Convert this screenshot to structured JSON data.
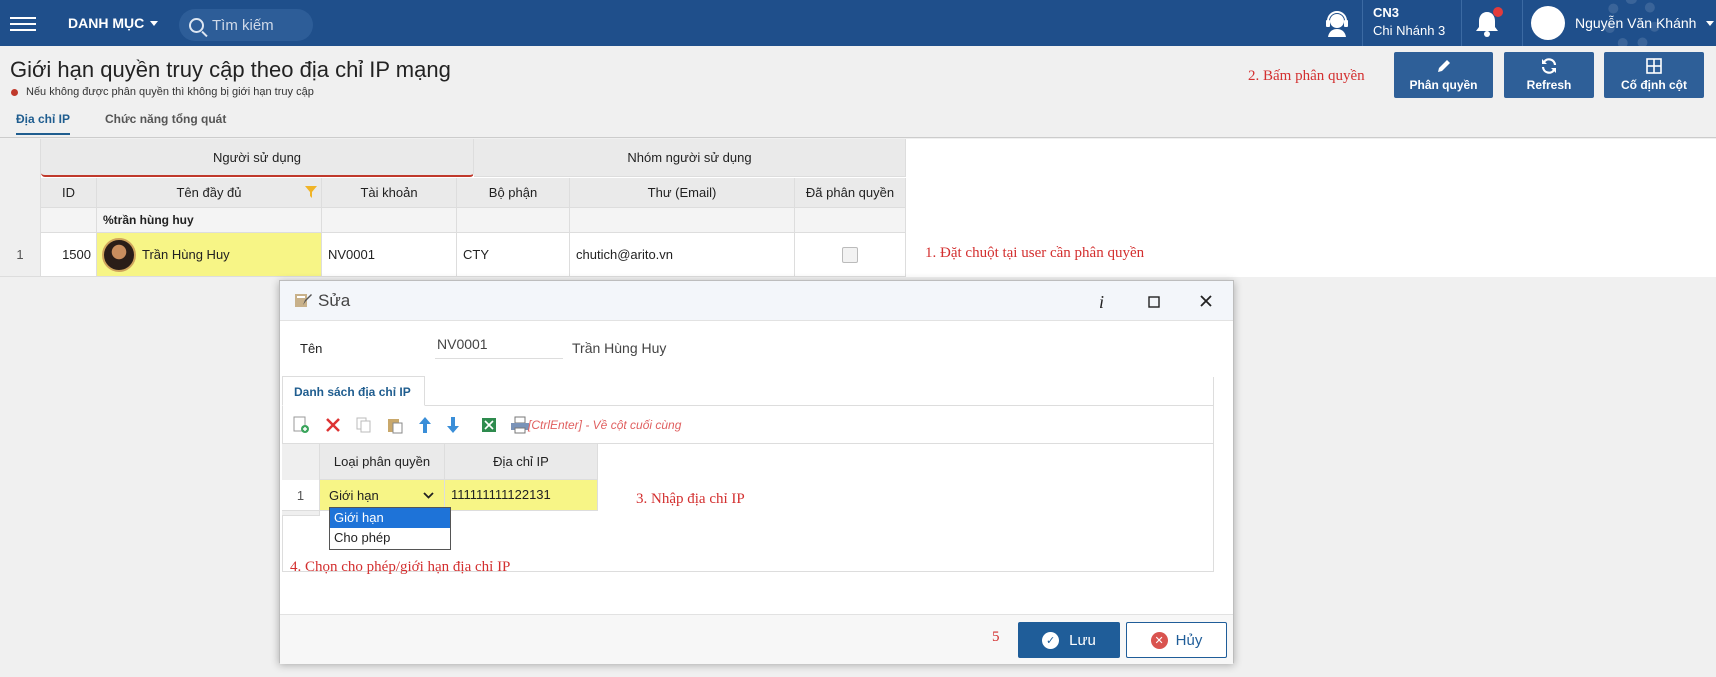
{
  "header": {
    "menu_label": "DANH MỤC",
    "search_placeholder": "Tìm kiếm",
    "branch_code": "CN3",
    "branch_name": "Chi Nhánh 3",
    "user_name": "Nguyễn Văn Khánh"
  },
  "page": {
    "title": "Giới hạn quyền truy cập theo địa chỉ IP mạng",
    "note": "Nếu không được phân quyền thì không bị giới hạn truy cập"
  },
  "toolbar": {
    "buttons": [
      {
        "label": "Phân quyền",
        "icon": "pencil-icon"
      },
      {
        "label": "Refresh",
        "icon": "refresh-icon"
      },
      {
        "label": "Cố định cột",
        "icon": "columns-icon"
      }
    ]
  },
  "tabs": [
    {
      "label": "Địa chỉ IP",
      "active": true
    },
    {
      "label": "Chức năng tổng quát",
      "active": false
    }
  ],
  "grid": {
    "group_headers": [
      "Người sử dụng",
      "Nhóm người sử dụng"
    ],
    "columns": [
      "ID",
      "Tên đầy đủ",
      "Tài khoản",
      "Bộ phận",
      "Thư (Email)",
      "Đã phân quyền"
    ],
    "filter_value": "%trần hùng huy",
    "rows": [
      {
        "index": "1",
        "id": "1500",
        "name": "Trần Hùng Huy",
        "account": "NV0001",
        "department": "CTY",
        "email": "chutich@arito.vn",
        "assigned": false
      }
    ]
  },
  "annotations": {
    "a1": "1. Đặt chuột tại user cần phân quyền",
    "a2": "2. Bấm phân quyền",
    "a3": "3. Nhập địa chỉ IP",
    "a4": "4. Chọn cho phép/giới hạn địa chỉ IP",
    "a5": "5"
  },
  "dialog": {
    "title": "Sửa",
    "name_label": "Tên",
    "code": "NV0001",
    "name": "Trần Hùng Huy",
    "tab_label": "Danh sách địa chỉ IP",
    "hint": "[CtrlEnter] - Về cột cuối cùng",
    "columns": [
      "Loại phân quyền",
      "Địa chỉ IP"
    ],
    "rows": [
      {
        "index": "1",
        "type": "Giới hạn",
        "ip": "111111111122131"
      }
    ],
    "dropdown_options": [
      "Giới hạn",
      "Cho phép"
    ],
    "save_label": "Lưu",
    "cancel_label": "Hủy"
  }
}
